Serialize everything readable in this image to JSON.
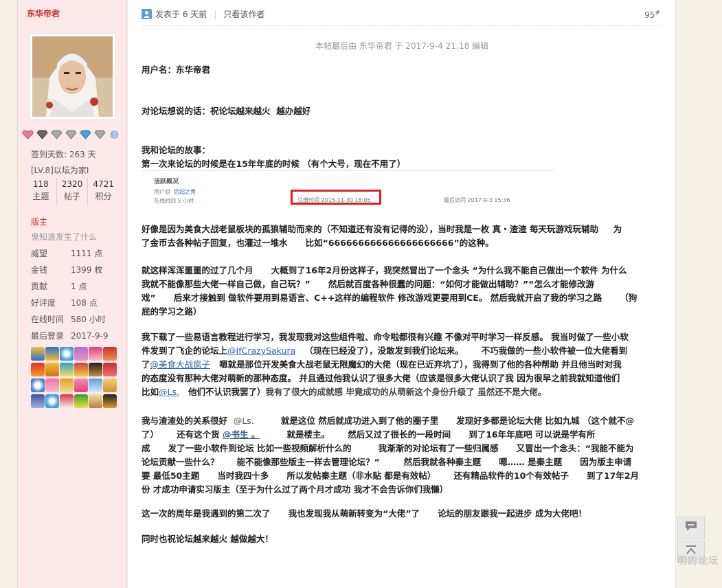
{
  "sidebar": {
    "username": "东华帝君",
    "signin_days": "签到天数: 263 天",
    "level": "[LV.8]以坛为家I",
    "stats": [
      {
        "num": "118",
        "label": "主题"
      },
      {
        "num": "2320",
        "label": "帖子"
      },
      {
        "num": "4721",
        "label": "积分"
      }
    ],
    "group_title": "版主",
    "group_sub": "鬼知道发生了什么",
    "info": [
      {
        "key": "威望",
        "value": "1111 点"
      },
      {
        "key": "金钱",
        "value": "1399 枚"
      },
      {
        "key": "贡献",
        "value": "1 点"
      },
      {
        "key": "好评度",
        "value": "108 点"
      },
      {
        "key": "在线时间",
        "value": "580 小时"
      },
      {
        "key": "最后登录",
        "value": "2017-9-9"
      }
    ]
  },
  "post": {
    "posted": "发表于 6 天前",
    "only_author": "只看该作者",
    "floor": "95",
    "floor_sup": "#",
    "edit_note": "本帖最后由 东华帝君 于 2017-9-4 21:18 编辑",
    "p_username": "用户名：东华帝君",
    "p_wish": "对论坛想说的话：祝论坛越来越火  越办越好",
    "p_story_title": "我和论坛的故事：",
    "p_first": "第一次来论坛的时候是在15年年底的时候 （有个大号，现在不用了）",
    "shot": {
      "title": "活跃概况",
      "group_label": "用户组",
      "group_value": "后起之秀",
      "online": "在线时间  5 小时",
      "register": "注册时间  2015-11-30 18:05",
      "last_visit": "最后访问  2017-9-3 15:36"
    },
    "p1": "好像是因为美食大战老鼠板块的孤狼辅助而来的（不知道还有没有记得的没），当时我是一枚 真・渣渣 每天玩游戏玩辅助     为\n了金币去各种帖子回复，也灌过一堆水      比如“666666666666666666666”的这种。",
    "p2": "就这样浑浑噩噩的过了几个月      大概到了16年2月份这样子，我突然冒出了一个念头 “为什么我不能自己做出一个软件 为什么\n我就不能像那些大佬一样自己做，自己玩？”      然后就百度各种很蠢的问题：“如何才能做出辅助？”“怎么才能修改游\n戏”      后来才接触到 做软件要用到易语言、C++这样的编程软件 修改游戏更要用到CE。 然后我就开启了我的学习之路      （狗\n屁的学习之路）",
    "p3_a": "我下载了一些易语言教程进行学习，我发现我对这些组件啦、命令啦都很有兴趣 不像对平时学习一样反感。 我当时做了一些小软\n件发到了飞企的论坛上",
    "p3_link1": "@IfCrazySakura",
    "p3_b": "   （现在已经没了），没敢发到我们论坛来。      不巧我做的一些小软件被一位大佬看到\n了",
    "p3_link2": "@美食大战疯子",
    "p3_c": "   嗯就是那位开发美食大战老鼠无限魔幻的大佬（现在已近弃坑了），我得到了他的各种帮助 并且他当时对我\n的态度没有那种大佬对萌新的那种态度。 并且通过他我认识了很多大佬（应该是很多大佬认识了我 因为很早之前我就知道他们\n比如",
    "p3_link3": "@Ls.",
    "p3_d": "   他们不认识我罢了）",
    "p3_e": "我有了很大的成就感 毕竟成功的从萌新这个身份升级了 虽然还不是大佬。",
    "p4_a": "我与渣渣处的关系很好  ",
    "p4_m1": "@Ls.",
    "p4_b": "         就是这位 然后就成功进入到了他的圈子里      发现好多都是论坛大佬 比如九城 （这个就不@\n了）      还有这个货 ",
    "p4_link": "@书生 。",
    "p4_c": "         就是楼主。      然后又过了很长的一段时间      到了16年年底吧 可以说是学有所\n成      发了一些小软件到论坛 比如一些视频解析什么的         我渐渐的对论坛有了一些归属感      又冒出一个念头：“我能不能为\n论坛贡献一些什么？      能不能像那些版主一样去管理论坛？”        然后我就各种秦主题      嗯…… 是秦主题      因为版主申请\n要 最低50主题      当时我四十多      所以发帖秦主题（非水贴 都是有效帖）      还有精品软件的10个有效帖子      到了17年2月\n份 才成功申请实习版主（至于为什么过了两个月才成功 我才不会告诉你们我懒）",
    "p5": "这一次的周年是我遇到的第二次了      我也发现我从萌新转变为“大佬”了      论坛的朋友跟我一起进步 成为大佬吧！",
    "p6": "同时也祝论坛越来越火 越做越大！"
  },
  "tools": {
    "watermark": "明的论坛"
  }
}
